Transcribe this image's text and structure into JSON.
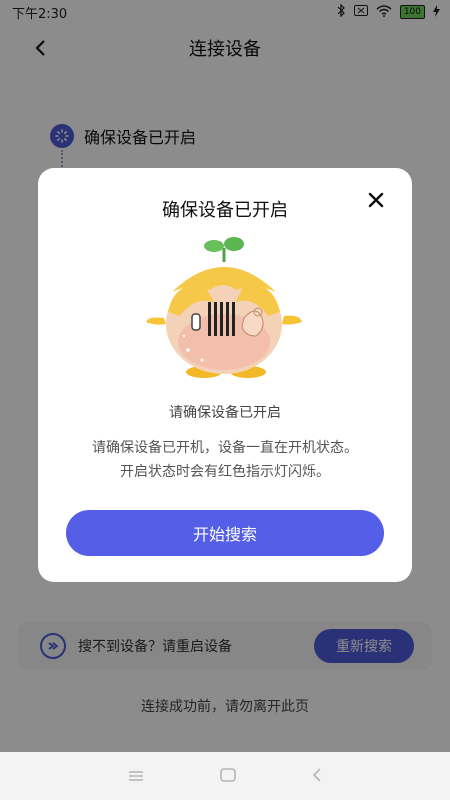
{
  "status_bar": {
    "time": "下午2:30",
    "battery": "100"
  },
  "header": {
    "title": "连接设备"
  },
  "page": {
    "step_label": "确保设备已开启",
    "help_text": "搜不到设备？请重启设备",
    "retry_label": "重新搜索",
    "footer_note": "连接成功前，请勿离开此页"
  },
  "modal": {
    "title": "确保设备已开启",
    "subtitle": "请确保设备已开启",
    "desc_line1": "请确保设备已开机，设备一直在开机状态。",
    "desc_line2": "开启状态时会有红色指示灯闪烁。",
    "button_label": "开始搜索"
  },
  "colors": {
    "accent": "#545ee6",
    "overlay": "rgba(0,0,0,0.45)"
  },
  "icons": [
    "bluetooth-icon",
    "sim-icon",
    "wifi-icon",
    "charging-icon",
    "back-icon",
    "close-icon",
    "loading-icon",
    "refresh-link-icon",
    "menu-icon",
    "home-icon",
    "back-nav-icon"
  ]
}
